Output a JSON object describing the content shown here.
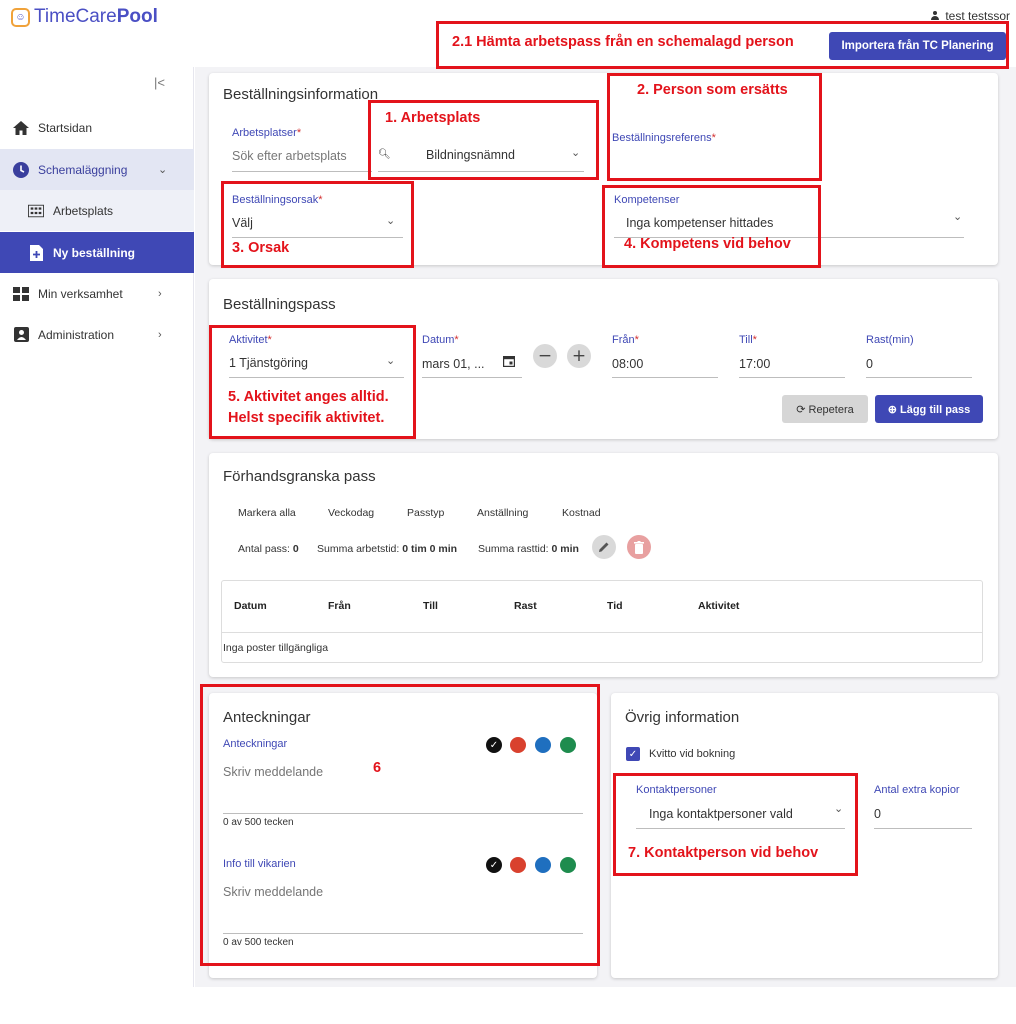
{
  "app": {
    "logo_thin": "TimeCare",
    "logo_bold": "Pool",
    "user": "test testssor",
    "import_button": "Importera från TC Planering"
  },
  "sidebar": {
    "collapse": "|<",
    "items": [
      {
        "label": "Startsidan"
      },
      {
        "label": "Schemaläggning"
      },
      {
        "label": "Arbetsplats"
      },
      {
        "label": "Ny beställning"
      },
      {
        "label": "Min verksamhet"
      },
      {
        "label": "Administration"
      }
    ]
  },
  "order_info": {
    "title": "Beställningsinformation",
    "workplaces_label": "Arbetsplatser",
    "workplaces_placeholder": "Sök efter arbetsplats",
    "workplace_value": "Bildningsnämnd",
    "reference_label": "Beställningsreferens",
    "reason_label": "Beställningsorsak",
    "reason_value": "Välj",
    "competences_label": "Kompetenser",
    "competences_value": "Inga kompetenser hittades"
  },
  "order_shift": {
    "title": "Beställningspass",
    "activity_label": "Aktivitet",
    "activity_value": "1 Tjänstgöring",
    "date_label": "Datum",
    "date_value": "mars 01, ...",
    "from_label": "Från",
    "from_value": "08:00",
    "to_label": "Till",
    "to_value": "17:00",
    "break_label": "Rast(min)",
    "break_value": "0",
    "repeat_button": "Repetera",
    "add_button": "Lägg till pass"
  },
  "preview": {
    "title": "Förhandsgranska pass",
    "filters": [
      "Markera alla",
      "Veckodag",
      "Passtyp",
      "Anställning",
      "Kostnad"
    ],
    "count_label": "Antal pass:",
    "count_value": "0",
    "work_label": "Summa arbetstid:",
    "work_value": "0 tim 0 min",
    "break_label": "Summa rasttid:",
    "break_value": "0 min",
    "columns": [
      "Datum",
      "Från",
      "Till",
      "Rast",
      "Tid",
      "Aktivitet"
    ],
    "empty": "Inga poster tillgängliga"
  },
  "notes": {
    "title": "Anteckningar",
    "notes_label": "Anteckningar",
    "notes_placeholder": "Skriv meddelande",
    "notes_counter": "0 av 500 tecken",
    "info_label": "Info till vikarien",
    "info_placeholder": "Skriv meddelande",
    "info_counter": "0 av 500 tecken",
    "colors": [
      "#111111",
      "#d9412e",
      "#1f6fbf",
      "#1e8c4e"
    ]
  },
  "other_info": {
    "title": "Övrig information",
    "receipt_label": "Kvitto vid bokning",
    "contacts_label": "Kontaktpersoner",
    "contacts_value": "Inga kontaktpersoner vald",
    "copies_label": "Antal extra kopior",
    "copies_value": "0"
  },
  "annotations": {
    "a21": "2.1 Hämta arbetspass från en schemalagd person",
    "a1": "1. Arbetsplats",
    "a2": "2. Person som ersätts",
    "a3": "3. Orsak",
    "a4": "4. Kompetens vid behov",
    "a5_line1": "5. Aktivitet anges alltid.",
    "a5_line2": "Helst specifik aktivitet.",
    "a6": "6",
    "a7": "7. Kontaktperson vid behov"
  }
}
